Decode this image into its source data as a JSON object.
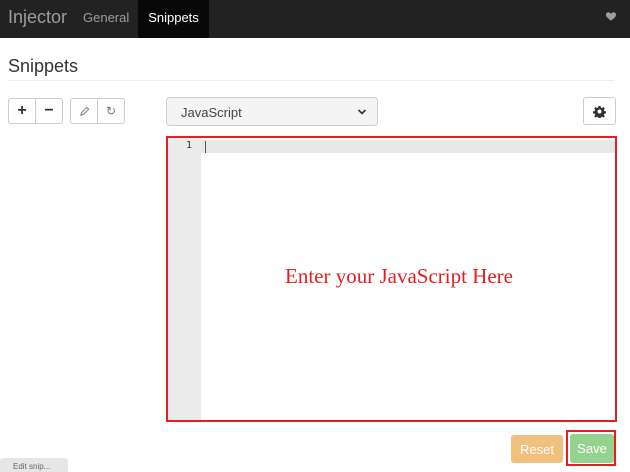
{
  "navbar": {
    "brand": "Injector",
    "tabs": [
      {
        "label": "General",
        "active": false
      },
      {
        "label": "Snippets",
        "active": true
      }
    ],
    "heart_icon": "heart-icon"
  },
  "page": {
    "title": "Snippets"
  },
  "toolbar": {
    "add_icon": "+",
    "remove_icon": "−",
    "edit_icon": "pencil-icon",
    "refresh_icon": "↻",
    "gear_icon": "gear-icon"
  },
  "language_select": {
    "value": "JavaScript"
  },
  "editor": {
    "line_numbers": [
      "1"
    ],
    "content": ""
  },
  "annotation": {
    "text": "Enter your JavaScript Here",
    "color": "#e51f1f"
  },
  "actions": {
    "reset_label": "Reset",
    "save_label": "Save"
  },
  "bottom_tab": {
    "label": "Edit snip..."
  },
  "colors": {
    "navbar_bg": "#222222",
    "active_tab_bg": "#080808",
    "reset_bg": "#f0c07c",
    "save_bg": "#94d38f"
  }
}
